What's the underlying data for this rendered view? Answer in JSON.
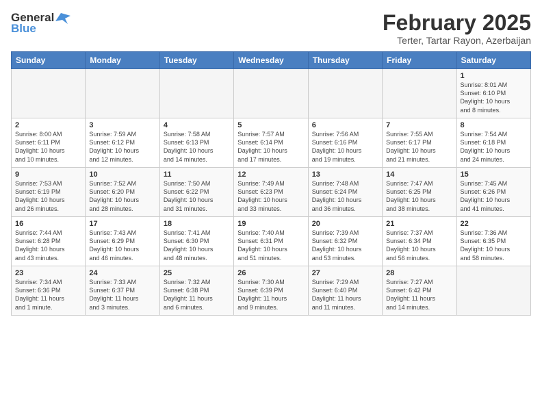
{
  "header": {
    "logo_general": "General",
    "logo_blue": "Blue",
    "main_title": "February 2025",
    "subtitle": "Terter, Tartar Rayon, Azerbaijan"
  },
  "days_of_week": [
    "Sunday",
    "Monday",
    "Tuesday",
    "Wednesday",
    "Thursday",
    "Friday",
    "Saturday"
  ],
  "weeks": [
    [
      {
        "day": "",
        "info": ""
      },
      {
        "day": "",
        "info": ""
      },
      {
        "day": "",
        "info": ""
      },
      {
        "day": "",
        "info": ""
      },
      {
        "day": "",
        "info": ""
      },
      {
        "day": "",
        "info": ""
      },
      {
        "day": "1",
        "info": "Sunrise: 8:01 AM\nSunset: 6:10 PM\nDaylight: 10 hours\nand 8 minutes."
      }
    ],
    [
      {
        "day": "2",
        "info": "Sunrise: 8:00 AM\nSunset: 6:11 PM\nDaylight: 10 hours\nand 10 minutes."
      },
      {
        "day": "3",
        "info": "Sunrise: 7:59 AM\nSunset: 6:12 PM\nDaylight: 10 hours\nand 12 minutes."
      },
      {
        "day": "4",
        "info": "Sunrise: 7:58 AM\nSunset: 6:13 PM\nDaylight: 10 hours\nand 14 minutes."
      },
      {
        "day": "5",
        "info": "Sunrise: 7:57 AM\nSunset: 6:14 PM\nDaylight: 10 hours\nand 17 minutes."
      },
      {
        "day": "6",
        "info": "Sunrise: 7:56 AM\nSunset: 6:16 PM\nDaylight: 10 hours\nand 19 minutes."
      },
      {
        "day": "7",
        "info": "Sunrise: 7:55 AM\nSunset: 6:17 PM\nDaylight: 10 hours\nand 21 minutes."
      },
      {
        "day": "8",
        "info": "Sunrise: 7:54 AM\nSunset: 6:18 PM\nDaylight: 10 hours\nand 24 minutes."
      }
    ],
    [
      {
        "day": "9",
        "info": "Sunrise: 7:53 AM\nSunset: 6:19 PM\nDaylight: 10 hours\nand 26 minutes."
      },
      {
        "day": "10",
        "info": "Sunrise: 7:52 AM\nSunset: 6:20 PM\nDaylight: 10 hours\nand 28 minutes."
      },
      {
        "day": "11",
        "info": "Sunrise: 7:50 AM\nSunset: 6:22 PM\nDaylight: 10 hours\nand 31 minutes."
      },
      {
        "day": "12",
        "info": "Sunrise: 7:49 AM\nSunset: 6:23 PM\nDaylight: 10 hours\nand 33 minutes."
      },
      {
        "day": "13",
        "info": "Sunrise: 7:48 AM\nSunset: 6:24 PM\nDaylight: 10 hours\nand 36 minutes."
      },
      {
        "day": "14",
        "info": "Sunrise: 7:47 AM\nSunset: 6:25 PM\nDaylight: 10 hours\nand 38 minutes."
      },
      {
        "day": "15",
        "info": "Sunrise: 7:45 AM\nSunset: 6:26 PM\nDaylight: 10 hours\nand 41 minutes."
      }
    ],
    [
      {
        "day": "16",
        "info": "Sunrise: 7:44 AM\nSunset: 6:28 PM\nDaylight: 10 hours\nand 43 minutes."
      },
      {
        "day": "17",
        "info": "Sunrise: 7:43 AM\nSunset: 6:29 PM\nDaylight: 10 hours\nand 46 minutes."
      },
      {
        "day": "18",
        "info": "Sunrise: 7:41 AM\nSunset: 6:30 PM\nDaylight: 10 hours\nand 48 minutes."
      },
      {
        "day": "19",
        "info": "Sunrise: 7:40 AM\nSunset: 6:31 PM\nDaylight: 10 hours\nand 51 minutes."
      },
      {
        "day": "20",
        "info": "Sunrise: 7:39 AM\nSunset: 6:32 PM\nDaylight: 10 hours\nand 53 minutes."
      },
      {
        "day": "21",
        "info": "Sunrise: 7:37 AM\nSunset: 6:34 PM\nDaylight: 10 hours\nand 56 minutes."
      },
      {
        "day": "22",
        "info": "Sunrise: 7:36 AM\nSunset: 6:35 PM\nDaylight: 10 hours\nand 58 minutes."
      }
    ],
    [
      {
        "day": "23",
        "info": "Sunrise: 7:34 AM\nSunset: 6:36 PM\nDaylight: 11 hours\nand 1 minute."
      },
      {
        "day": "24",
        "info": "Sunrise: 7:33 AM\nSunset: 6:37 PM\nDaylight: 11 hours\nand 3 minutes."
      },
      {
        "day": "25",
        "info": "Sunrise: 7:32 AM\nSunset: 6:38 PM\nDaylight: 11 hours\nand 6 minutes."
      },
      {
        "day": "26",
        "info": "Sunrise: 7:30 AM\nSunset: 6:39 PM\nDaylight: 11 hours\nand 9 minutes."
      },
      {
        "day": "27",
        "info": "Sunrise: 7:29 AM\nSunset: 6:40 PM\nDaylight: 11 hours\nand 11 minutes."
      },
      {
        "day": "28",
        "info": "Sunrise: 7:27 AM\nSunset: 6:42 PM\nDaylight: 11 hours\nand 14 minutes."
      },
      {
        "day": "",
        "info": ""
      }
    ]
  ]
}
